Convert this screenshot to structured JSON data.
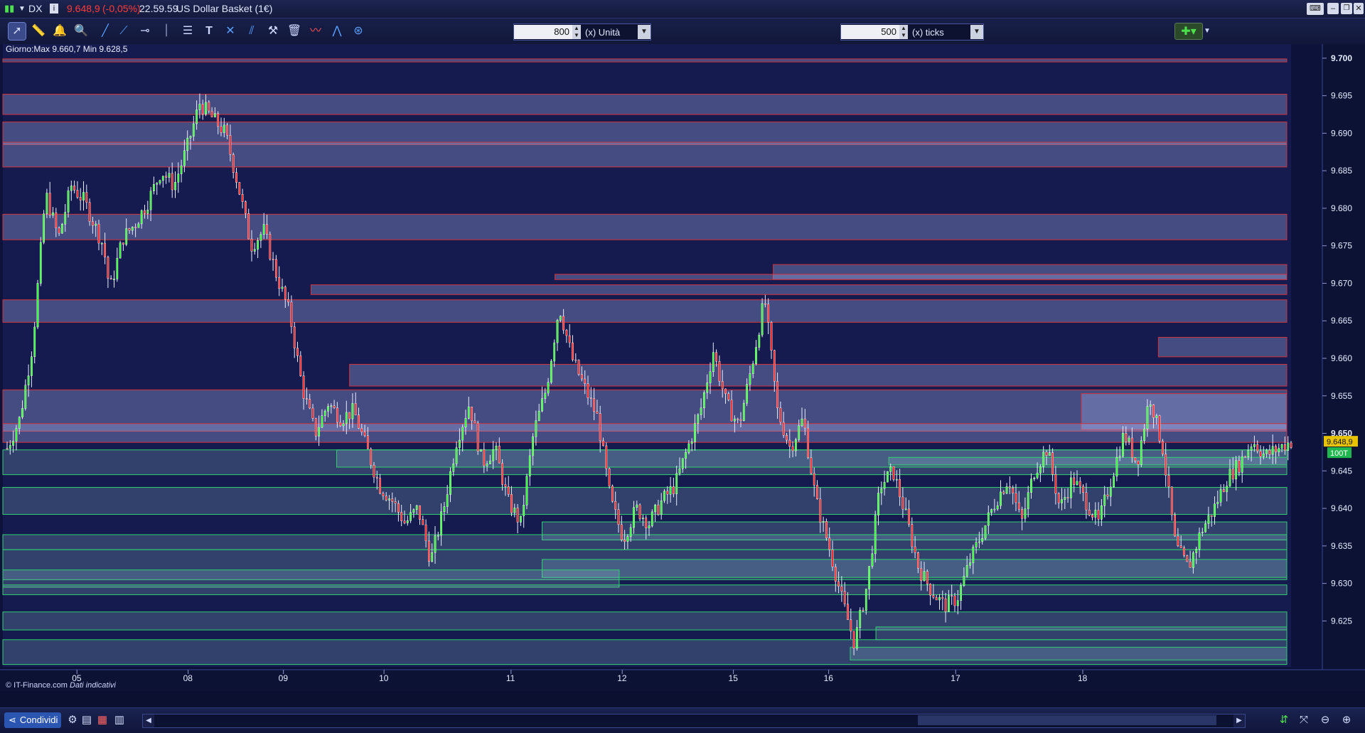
{
  "window": {
    "symbol": "DX",
    "price": "9.648,9",
    "change": "(-0,05%)",
    "time": "22.59.59",
    "instrument": "US Dollar Basket (1€)"
  },
  "toolbar": {
    "tools": [
      "pointer-tool",
      "ruler-tool",
      "alert-bell-tool",
      "zoom-tool",
      "trendline-tool",
      "ray-tool",
      "horizontal-line-tool",
      "vertical-line-tool",
      "fibonacci-tool",
      "text-tool",
      "cross-line-tool",
      "parallel-lines-tool",
      "tools-settings",
      "trash-tool",
      "indicators-tool",
      "studies-tool"
    ],
    "bar_size": {
      "value": "800",
      "unit": "(x) Unità"
    },
    "tick_size": {
      "value": "500",
      "unit": "(x) ticks"
    }
  },
  "chart": {
    "info_line": "Giorno:Max 9.660,7 Min 9.628,5",
    "credit": "© IT-Finance.com",
    "credit_note": "Dati indicativi",
    "last_price_label": "9.648,9",
    "volume_badge": "100T",
    "bold_axis_labels": [
      "9.700",
      "9.650"
    ]
  },
  "chart_data": {
    "type": "candlestick",
    "y_axis_ticks": [
      "9.700",
      "9.695",
      "9.690",
      "9.685",
      "9.680",
      "9.675",
      "9.670",
      "9.665",
      "9.660",
      "9.655",
      "9.650",
      "9.645",
      "9.640",
      "9.635",
      "9.630",
      "9.625"
    ],
    "ylim": [
      9.6185,
      9.7015
    ],
    "x_axis_ticks": [
      "05",
      "08",
      "09",
      "10",
      "11",
      "12",
      "15",
      "16",
      "17",
      "18"
    ],
    "x_tick_positions": [
      7,
      17.5,
      26.5,
      36,
      48,
      58.5,
      69,
      78,
      90,
      102
    ],
    "x_range": [
      0,
      102
    ],
    "anchors": [
      [
        0,
        9.648
      ],
      [
        1,
        9.652
      ],
      [
        2,
        9.662
      ],
      [
        3,
        9.682
      ],
      [
        4,
        9.676
      ],
      [
        5,
        9.683
      ],
      [
        6,
        9.681
      ],
      [
        7.5,
        9.675
      ],
      [
        8,
        9.669
      ],
      [
        9,
        9.676
      ],
      [
        10,
        9.678
      ],
      [
        11,
        9.681
      ],
      [
        12,
        9.685
      ],
      [
        13,
        9.683
      ],
      [
        14,
        9.688
      ],
      [
        15,
        9.694
      ],
      [
        16,
        9.692
      ],
      [
        17,
        9.69
      ],
      [
        18,
        9.683
      ],
      [
        19,
        9.675
      ],
      [
        20,
        9.677
      ],
      [
        21,
        9.671
      ],
      [
        22,
        9.666
      ],
      [
        23,
        9.656
      ],
      [
        24,
        9.65
      ],
      [
        25,
        9.654
      ],
      [
        26,
        9.652
      ],
      [
        27,
        9.653
      ],
      [
        28,
        9.648
      ],
      [
        29,
        9.643
      ],
      [
        30,
        9.641
      ],
      [
        31,
        9.638
      ],
      [
        32,
        9.64
      ],
      [
        33,
        9.633
      ],
      [
        34,
        9.64
      ],
      [
        35,
        9.649
      ],
      [
        36,
        9.654
      ],
      [
        37,
        9.646
      ],
      [
        38,
        9.648
      ],
      [
        39,
        9.641
      ],
      [
        40,
        9.638
      ],
      [
        41,
        9.65
      ],
      [
        42,
        9.656
      ],
      [
        43,
        9.667
      ],
      [
        44,
        9.66
      ],
      [
        45,
        9.656
      ],
      [
        46,
        9.652
      ],
      [
        47,
        9.641
      ],
      [
        48,
        9.636
      ],
      [
        49,
        9.64
      ],
      [
        50,
        9.638
      ],
      [
        51,
        9.641
      ],
      [
        52,
        9.643
      ],
      [
        53,
        9.648
      ],
      [
        54,
        9.653
      ],
      [
        55,
        9.661
      ],
      [
        56,
        9.654
      ],
      [
        57,
        9.651
      ],
      [
        58,
        9.659
      ],
      [
        59,
        9.668
      ],
      [
        60,
        9.653
      ],
      [
        61,
        9.648
      ],
      [
        62,
        9.652
      ],
      [
        63,
        9.641
      ],
      [
        64,
        9.635
      ],
      [
        65,
        9.628
      ],
      [
        66,
        9.622
      ],
      [
        67,
        9.63
      ],
      [
        68,
        9.643
      ],
      [
        69,
        9.645
      ],
      [
        70,
        9.639
      ],
      [
        71,
        9.632
      ],
      [
        72,
        9.629
      ],
      [
        73,
        9.627
      ],
      [
        74,
        9.628
      ],
      [
        75,
        9.633
      ],
      [
        76,
        9.637
      ],
      [
        77,
        9.641
      ],
      [
        78,
        9.644
      ],
      [
        79,
        9.638
      ],
      [
        80,
        9.645
      ],
      [
        81,
        9.648
      ],
      [
        82,
        9.64
      ],
      [
        83,
        9.644
      ],
      [
        84,
        9.641
      ],
      [
        85,
        9.638
      ],
      [
        86,
        9.644
      ],
      [
        87,
        9.65
      ],
      [
        88,
        9.646
      ],
      [
        89,
        9.655
      ],
      [
        90,
        9.648
      ],
      [
        91,
        9.635
      ],
      [
        92,
        9.632
      ],
      [
        93,
        9.637
      ],
      [
        94,
        9.64
      ],
      [
        95,
        9.644
      ],
      [
        96,
        9.646
      ],
      [
        97,
        9.649
      ],
      [
        98,
        9.647
      ],
      [
        99,
        9.648
      ],
      [
        100,
        9.6489
      ]
    ],
    "resistance_zones": [
      {
        "x0": 0,
        "x1": 100,
        "y0": 9.6995,
        "y1": 9.6999
      },
      {
        "x0": 0,
        "x1": 100,
        "y0": 9.6925,
        "y1": 9.6952
      },
      {
        "x0": 0,
        "x1": 100,
        "y0": 9.6885,
        "y1": 9.6915
      },
      {
        "x0": 0,
        "x1": 100,
        "y0": 9.6855,
        "y1": 9.6888
      },
      {
        "x0": 0,
        "x1": 100,
        "y0": 9.6758,
        "y1": 9.6792
      },
      {
        "x0": 60,
        "x1": 100,
        "y0": 9.6705,
        "y1": 9.6725
      },
      {
        "x0": 43,
        "x1": 100,
        "y0": 9.6705,
        "y1": 9.6712
      },
      {
        "x0": 24,
        "x1": 100,
        "y0": 9.6685,
        "y1": 9.6698
      },
      {
        "x0": 0,
        "x1": 100,
        "y0": 9.6648,
        "y1": 9.6678
      },
      {
        "x0": 90,
        "x1": 100,
        "y0": 9.6602,
        "y1": 9.6628
      },
      {
        "x0": 27,
        "x1": 100,
        "y0": 9.6563,
        "y1": 9.6592
      },
      {
        "x0": 0,
        "x1": 100,
        "y0": 9.6503,
        "y1": 9.6558
      },
      {
        "x0": 84,
        "x1": 100,
        "y0": 9.6505,
        "y1": 9.6553
      },
      {
        "x0": 0,
        "x1": 100,
        "y0": 9.6488,
        "y1": 9.6513
      }
    ],
    "support_zones": [
      {
        "x0": 0,
        "x1": 100,
        "y0": 9.6445,
        "y1": 9.6478
      },
      {
        "x0": 26,
        "x1": 100,
        "y0": 9.6455,
        "y1": 9.6478
      },
      {
        "x0": 69,
        "x1": 100,
        "y0": 9.6458,
        "y1": 9.6468
      },
      {
        "x0": 0,
        "x1": 100,
        "y0": 9.6392,
        "y1": 9.6428
      },
      {
        "x0": 42,
        "x1": 100,
        "y0": 9.6358,
        "y1": 9.6382
      },
      {
        "x0": 0,
        "x1": 100,
        "y0": 9.6345,
        "y1": 9.6365
      },
      {
        "x0": 0,
        "x1": 100,
        "y0": 9.6305,
        "y1": 9.6345
      },
      {
        "x0": 42,
        "x1": 100,
        "y0": 9.6308,
        "y1": 9.6332
      },
      {
        "x0": 0,
        "x1": 48,
        "y0": 9.6295,
        "y1": 9.6318
      },
      {
        "x0": 0,
        "x1": 100,
        "y0": 9.6285,
        "y1": 9.6298
      },
      {
        "x0": 0,
        "x1": 100,
        "y0": 9.6238,
        "y1": 9.6262
      },
      {
        "x0": 68,
        "x1": 100,
        "y0": 9.6225,
        "y1": 9.6242
      },
      {
        "x0": 0,
        "x1": 100,
        "y0": 9.6192,
        "y1": 9.6225
      },
      {
        "x0": 66,
        "x1": 100,
        "y0": 9.6198,
        "y1": 9.6215
      }
    ],
    "colors": {
      "up": "#37ff37",
      "down": "#ff2a2a",
      "resistance_edge": "#d0323c",
      "support_edge": "#2fd070",
      "background": "#151b4e",
      "axis_bg": "#0c1234"
    }
  },
  "bottom": {
    "share_label": "Condividi",
    "icons": [
      "templates-icon",
      "chart-list-icon",
      "layout-icon",
      "scroll-left-icon",
      "scroll-right-icon",
      "auto-scale-icon",
      "fit-icon",
      "zoom-out-icon",
      "zoom-in-icon"
    ]
  }
}
